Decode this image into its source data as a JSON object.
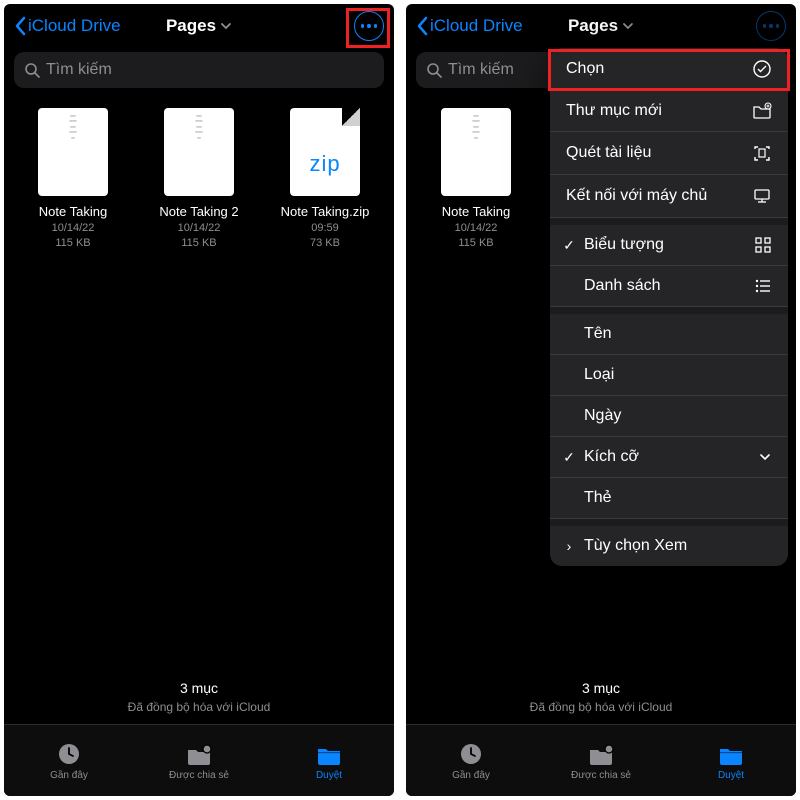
{
  "nav": {
    "back_label": "iCloud Drive",
    "title": "Pages"
  },
  "search": {
    "placeholder": "Tìm kiếm"
  },
  "files": [
    {
      "name": "Note Taking",
      "date": "10/14/22",
      "size": "115 KB",
      "type": "doc"
    },
    {
      "name": "Note Taking 2",
      "date": "10/14/22",
      "size": "115 KB",
      "type": "doc"
    },
    {
      "name": "Note Taking.zip",
      "date": "09:59",
      "size": "73 KB",
      "type": "zip",
      "ziplabel": "zip"
    }
  ],
  "status": {
    "count": "3 mục",
    "sync": "Đã đồng bộ hóa với iCloud"
  },
  "tabs": {
    "recent": "Gần đây",
    "shared": "Được chia sẻ",
    "browse": "Duyệt"
  },
  "menu": {
    "select": "Chọn",
    "new_folder": "Thư mục mới",
    "scan": "Quét tài liệu",
    "connect": "Kết nối với máy chủ",
    "icons": "Biểu tượng",
    "list": "Danh sách",
    "name": "Tên",
    "kind": "Loại",
    "date_sort": "Ngày",
    "size_sort": "Kích cỡ",
    "tags": "Thẻ",
    "view_options": "Tùy chọn Xem"
  }
}
